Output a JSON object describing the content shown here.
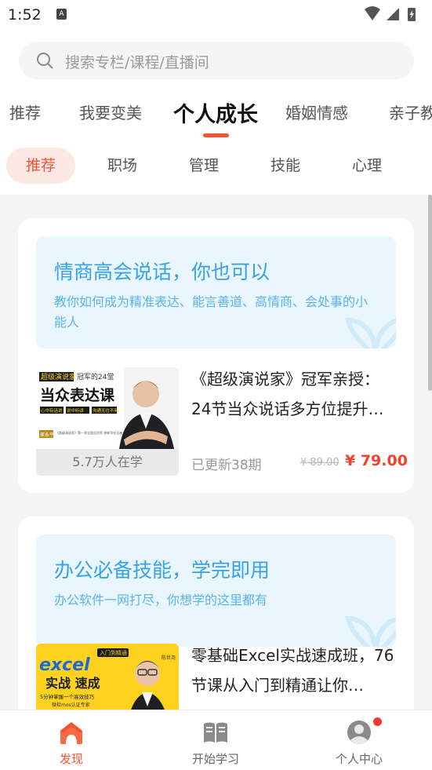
{
  "status_bar": {
    "time": "1:52",
    "notification_icon": "A"
  },
  "search": {
    "placeholder": "搜索专栏/课程/直播间"
  },
  "category_tabs": [
    {
      "label": "推荐",
      "active": false
    },
    {
      "label": "我要变美",
      "active": false
    },
    {
      "label": "个人成长",
      "active": true
    },
    {
      "label": "婚姻情感",
      "active": false
    },
    {
      "label": "亲子教",
      "active": false
    }
  ],
  "sub_tabs": [
    {
      "label": "推荐",
      "active": true
    },
    {
      "label": "职场",
      "active": false
    },
    {
      "label": "管理",
      "active": false
    },
    {
      "label": "技能",
      "active": false
    },
    {
      "label": "心理",
      "active": false
    }
  ],
  "cards": [
    {
      "banner_title": "情商高会说话，你也可以",
      "banner_subtitle": "教你如何成为精准表达、能言善道、高情商、会处事的小能人",
      "course": {
        "thumb_brand": "超级演说家",
        "thumb_tag": "冠军的24堂",
        "thumb_headline": "当众表达课",
        "thumb_tags": [
          "心中有话说",
          "说中听讲",
          "沟通无往不利"
        ],
        "thumb_name": "崔永平",
        "thumb_note": "《超级演说家》第一季全国总冠军 原新华社记者 / 演员 / 知名教育导师",
        "learners": "5.7万人在学",
        "title": "《超级演说家》冠军亲授：24节当众说话多方位提升…",
        "updated": "已更新38期",
        "price_old": "¥ 89.00",
        "price_new": "¥ 79.00"
      }
    },
    {
      "banner_title": "办公必备技能，学完即用",
      "banner_subtitle": "办公软件一网打尽，你想学的这里都有",
      "course": {
        "thumb_tag": "入门到精通",
        "thumb_brand": "excel",
        "thumb_headline": "实战 速成",
        "thumb_sub": "5分钟掌握一个高效技巧",
        "thumb_note": "微软mos认证专家",
        "thumb_name": "陈世尧",
        "title": "零基础Excel实战速成班，76节课从入门到精通让你…"
      }
    }
  ],
  "bottom_nav": [
    {
      "label": "发现",
      "icon": "house-icon",
      "active": true
    },
    {
      "label": "开始学习",
      "icon": "book-icon",
      "active": false
    },
    {
      "label": "个人中心",
      "icon": "person-icon",
      "active": false,
      "badge": true
    }
  ],
  "colors": {
    "accent": "#f25433",
    "banner_bg": "#eaf6fd",
    "banner_text": "#36a3e6",
    "price": "#f0432d"
  }
}
